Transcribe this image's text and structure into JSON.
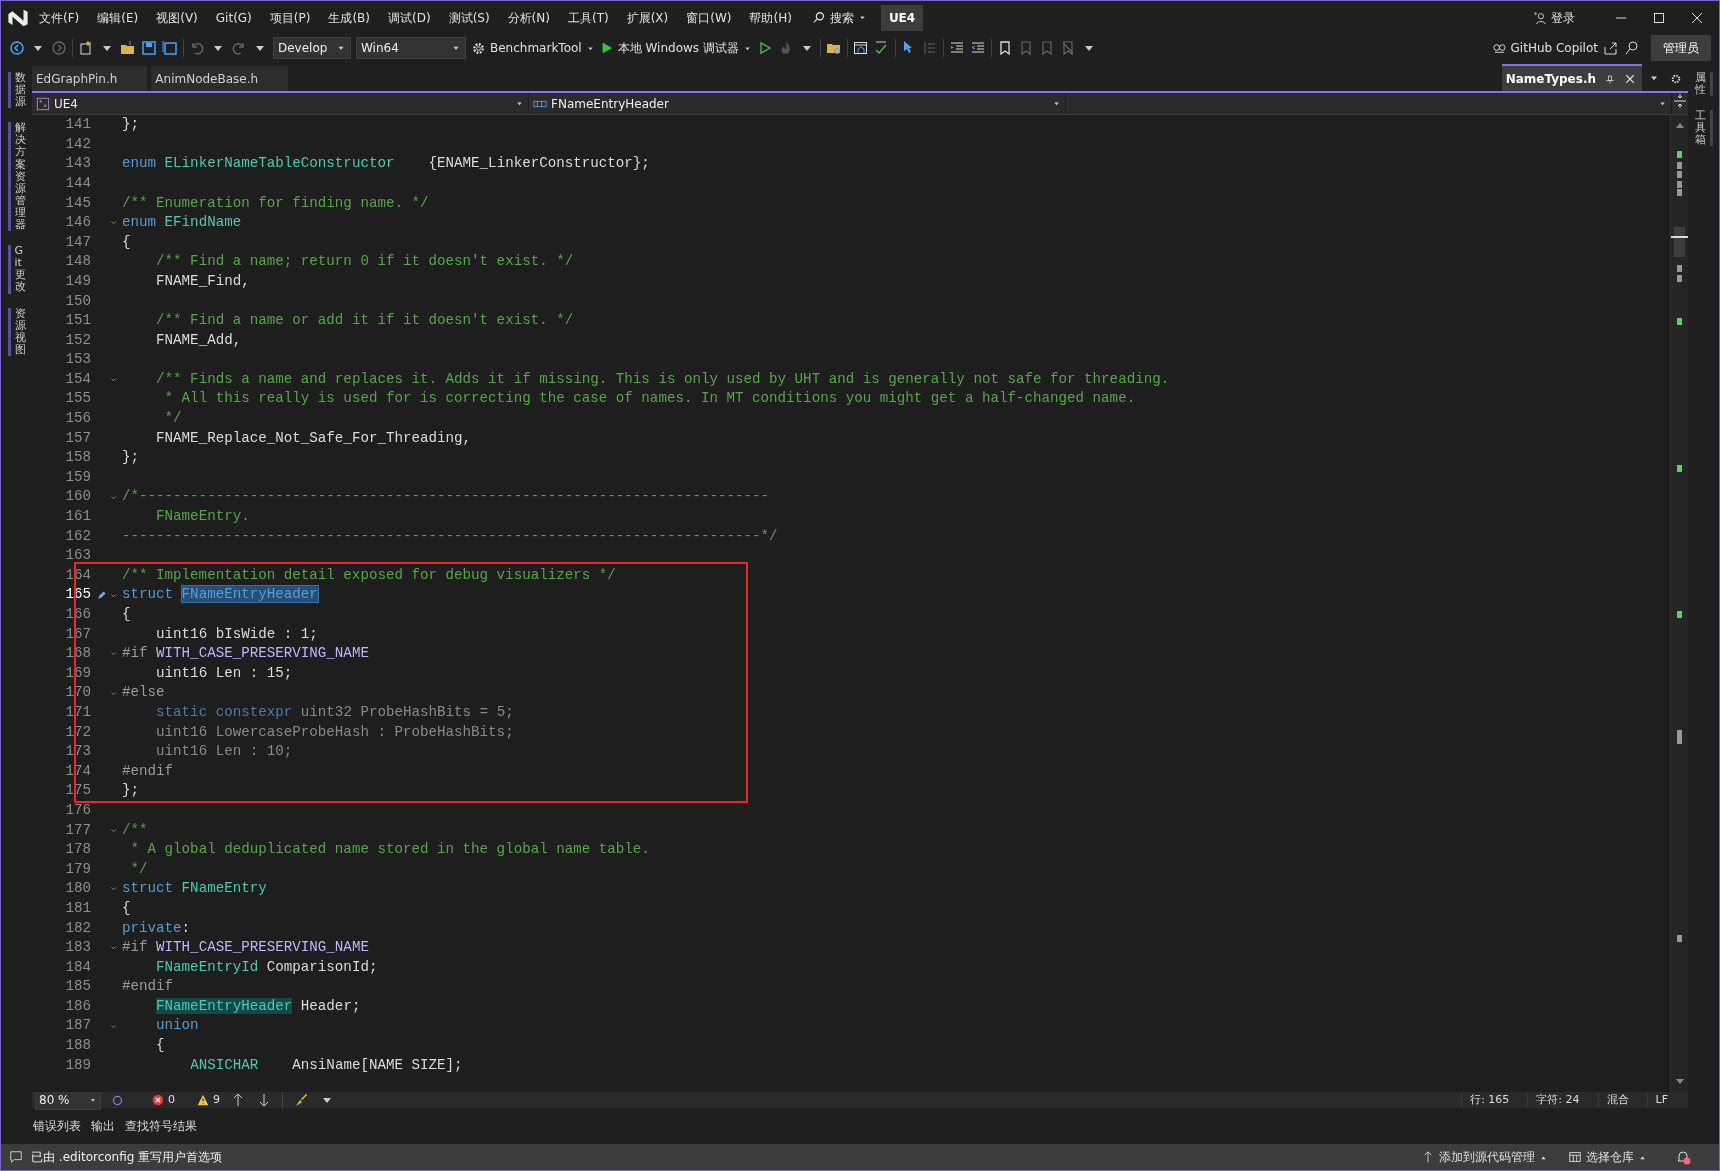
{
  "title_bar": {
    "menus": [
      "文件(F)",
      "编辑(E)",
      "视图(V)",
      "Git(G)",
      "项目(P)",
      "生成(B)",
      "调试(D)",
      "测试(S)",
      "分析(N)",
      "工具(T)",
      "扩展(X)",
      "窗口(W)",
      "帮助(H)"
    ],
    "search": "搜索",
    "solution": "UE4",
    "sign_in": "登录"
  },
  "toolbar": {
    "configuration": "Develop",
    "platform": "Win64",
    "startup_project": "BenchmarkTool",
    "debugger": "本地 Windows 调试器",
    "copilot": "GitHub Copilot",
    "admin": "管理员"
  },
  "left_tool_tabs": [
    "数据源",
    "解决方案资源管理器",
    "Git 更改",
    "资源视图"
  ],
  "right_tool_tabs": [
    "属性",
    "工具箱"
  ],
  "document_tabs": [
    {
      "label": "EdGraphPin.h",
      "selected": false
    },
    {
      "label": "AnimNodeBase.h",
      "selected": false
    },
    {
      "label": "NameTypes.h",
      "selected": true
    }
  ],
  "navigation_bar": {
    "project": "UE4",
    "symbol": "FNameEntryHeader"
  },
  "code_sections": [
    {
      "boxed": false,
      "lines": [
        {
          "number": "141",
          "fold": false,
          "current": false,
          "segments": [
            {
              "kind": "plain",
              "text": "};"
            }
          ]
        },
        {
          "number": "142",
          "fold": false,
          "current": false
        },
        {
          "number": "143",
          "fold": false,
          "current": false,
          "segments": [
            {
              "kind": "keyword",
              "text": "enum"
            },
            {
              "kind": "type",
              "text": " ELinkerNameTableConstructor"
            },
            {
              "kind": "plain",
              "text": "    {ENAME_LinkerConstructor};"
            }
          ]
        },
        {
          "number": "144",
          "fold": false,
          "current": false
        },
        {
          "number": "145",
          "fold": false,
          "current": false,
          "segments": [
            {
              "kind": "comment",
              "text": "/** Enumeration for finding name. */"
            }
          ]
        },
        {
          "number": "146",
          "fold": true,
          "current": false,
          "segments": [
            {
              "kind": "keyword",
              "text": "enum"
            },
            {
              "kind": "type",
              "text": " EFindName"
            }
          ]
        },
        {
          "number": "147",
          "fold": false,
          "current": false,
          "segments": [
            {
              "kind": "plain",
              "text": "{"
            }
          ]
        },
        {
          "number": "148",
          "fold": false,
          "current": false,
          "segments": [
            {
              "kind": "comment",
              "text": "    /** Find a name; return 0 if it doesn't exist. */"
            }
          ]
        },
        {
          "number": "149",
          "fold": false,
          "current": false,
          "segments": [
            {
              "kind": "plain",
              "text": "    FNAME_Find,"
            }
          ]
        },
        {
          "number": "150",
          "fold": false,
          "current": false
        },
        {
          "number": "151",
          "fold": false,
          "current": false,
          "segments": [
            {
              "kind": "comment",
              "text": "    /** Find a name or add it if it doesn't exist. */"
            }
          ]
        },
        {
          "number": "152",
          "fold": false,
          "current": false,
          "segments": [
            {
              "kind": "plain",
              "text": "    FNAME_Add,"
            }
          ]
        },
        {
          "number": "153",
          "fold": false,
          "current": false
        },
        {
          "number": "154",
          "fold": true,
          "current": false,
          "segments": [
            {
              "kind": "comment",
              "text": "    /** Finds a name and replaces it. Adds it if missing. This is only used by UHT and is generally not safe for threading."
            }
          ]
        },
        {
          "number": "155",
          "fold": false,
          "current": false,
          "segments": [
            {
              "kind": "comment",
              "text": "     * All this really is used for is correcting the case of names. In MT conditions you might get a half-changed name."
            }
          ]
        },
        {
          "number": "156",
          "fold": false,
          "current": false,
          "segments": [
            {
              "kind": "comment",
              "text": "     */"
            }
          ]
        },
        {
          "number": "157",
          "fold": false,
          "current": false,
          "segments": [
            {
              "kind": "plain",
              "text": "    FNAME_Replace_Not_Safe_For_Threading,"
            }
          ]
        },
        {
          "number": "158",
          "fold": false,
          "current": false,
          "segments": [
            {
              "kind": "plain",
              "text": "};"
            }
          ]
        },
        {
          "number": "159",
          "fold": false,
          "current": false
        },
        {
          "number": "160",
          "fold": true,
          "current": false,
          "segments": [
            {
              "kind": "comment",
              "text": "/*--------------------------------------------------------------------------"
            }
          ]
        },
        {
          "number": "161",
          "fold": false,
          "current": false,
          "segments": [
            {
              "kind": "comment",
              "text": "    FNameEntry."
            }
          ]
        },
        {
          "number": "162",
          "fold": false,
          "current": false,
          "segments": [
            {
              "kind": "comment",
              "text": "---------------------------------------------------------------------------*/"
            }
          ]
        },
        {
          "number": "163",
          "fold": false,
          "current": false
        }
      ]
    },
    {
      "boxed": true,
      "lines": [
        {
          "number": "164",
          "fold": false,
          "current": false,
          "segments": [
            {
              "kind": "comment",
              "text": "/** Implementation detail exposed for debug visualizers */"
            }
          ]
        },
        {
          "number": "165",
          "fold": true,
          "current": true,
          "segments": [
            {
              "kind": "keyword",
              "text": "struct"
            },
            {
              "kind": "selected",
              "text": " FNameEntryHeader"
            }
          ]
        },
        {
          "number": "166",
          "fold": false,
          "current": false,
          "segments": [
            {
              "kind": "plain",
              "text": "{"
            }
          ]
        },
        {
          "number": "167",
          "fold": false,
          "current": false,
          "segments": [
            {
              "kind": "plain",
              "text": "    uint16 bIsWide : 1;"
            }
          ]
        },
        {
          "number": "168",
          "fold": true,
          "current": false,
          "segments": [
            {
              "kind": "preprocessor",
              "text": "#if"
            },
            {
              "kind": "macro",
              "text": " WITH_CASE_PRESERVING_NAME"
            }
          ]
        },
        {
          "number": "169",
          "fold": false,
          "current": false,
          "segments": [
            {
              "kind": "plain",
              "text": "    uint16 Len : 15;"
            }
          ]
        },
        {
          "number": "170",
          "fold": true,
          "current": false,
          "segments": [
            {
              "kind": "preprocessor",
              "text": "#else"
            }
          ]
        },
        {
          "number": "171",
          "fold": false,
          "current": false,
          "segments": [
            {
              "kind": "inactive_keyword",
              "text": "    static constexpr"
            },
            {
              "kind": "inactive",
              "text": " uint32 ProbeHashBits = 5;"
            }
          ]
        },
        {
          "number": "172",
          "fold": false,
          "current": false,
          "segments": [
            {
              "kind": "inactive",
              "text": "    uint16 LowercaseProbeHash : ProbeHashBits;"
            }
          ]
        },
        {
          "number": "173",
          "fold": false,
          "current": false,
          "segments": [
            {
              "kind": "inactive",
              "text": "    uint16 Len : 10;"
            }
          ]
        },
        {
          "number": "174",
          "fold": false,
          "current": false,
          "segments": [
            {
              "kind": "preprocessor",
              "text": "#endif"
            }
          ]
        },
        {
          "number": "175",
          "fold": false,
          "current": false,
          "segments": [
            {
              "kind": "plain",
              "text": "};"
            }
          ]
        }
      ]
    },
    {
      "boxed": false,
      "lines": [
        {
          "number": "176",
          "fold": false,
          "current": false
        },
        {
          "number": "177",
          "fold": true,
          "current": false,
          "segments": [
            {
              "kind": "comment",
              "text": "/**"
            }
          ]
        },
        {
          "number": "178",
          "fold": false,
          "current": false,
          "segments": [
            {
              "kind": "comment",
              "text": " * A global deduplicated name stored in the global name table."
            }
          ]
        },
        {
          "number": "179",
          "fold": false,
          "current": false,
          "segments": [
            {
              "kind": "comment",
              "text": " */"
            }
          ]
        },
        {
          "number": "180",
          "fold": true,
          "current": false,
          "segments": [
            {
              "kind": "keyword",
              "text": "struct"
            },
            {
              "kind": "type",
              "text": " FNameEntry"
            }
          ]
        },
        {
          "number": "181",
          "fold": false,
          "current": false,
          "segments": [
            {
              "kind": "plain",
              "text": "{"
            }
          ]
        },
        {
          "number": "182",
          "fold": false,
          "current": false,
          "segments": [
            {
              "kind": "keyword",
              "text": "private"
            },
            {
              "kind": "plain",
              "text": ":"
            }
          ]
        },
        {
          "number": "183",
          "fold": true,
          "current": false,
          "segments": [
            {
              "kind": "preprocessor",
              "text": "#if"
            },
            {
              "kind": "macro",
              "text": " WITH_CASE_PRESERVING_NAME"
            }
          ]
        },
        {
          "number": "184",
          "fold": false,
          "current": false,
          "segments": [
            {
              "kind": "type",
              "text": "    FNameEntryId"
            },
            {
              "kind": "plain",
              "text": " ComparisonId;"
            }
          ]
        },
        {
          "number": "185",
          "fold": false,
          "current": false,
          "segments": [
            {
              "kind": "preprocessor",
              "text": "#endif"
            }
          ]
        },
        {
          "number": "186",
          "fold": false,
          "current": false,
          "segments": [
            {
              "kind": "reference",
              "text": "    FNameEntryHeader"
            },
            {
              "kind": "plain",
              "text": " Header;"
            }
          ]
        },
        {
          "number": "187",
          "fold": true,
          "current": false,
          "segments": [
            {
              "kind": "keyword",
              "text": "    union"
            }
          ]
        },
        {
          "number": "188",
          "fold": false,
          "current": false,
          "segments": [
            {
              "kind": "plain",
              "text": "    {"
            }
          ]
        },
        {
          "number": "189",
          "fold": false,
          "current": false,
          "segments": [
            {
              "kind": "type",
              "text": "        ANSICHAR"
            },
            {
              "kind": "plain",
              "text": "    AnsiName[NAME SIZE];"
            }
          ]
        }
      ]
    }
  ],
  "editor_status": {
    "zoom": "80 %",
    "errors": "0",
    "warnings": "9",
    "line": "行: 165",
    "column": "字符: 24",
    "encoding": "混合",
    "line_ending": "LF"
  },
  "panel_tabs": [
    "错误列表",
    "输出",
    "查找符号结果"
  ],
  "status_bar": {
    "message": "已由 .editorconfig 重写用户首选项",
    "source_control": "添加到源代码管理",
    "repository": "选择仓库"
  }
}
